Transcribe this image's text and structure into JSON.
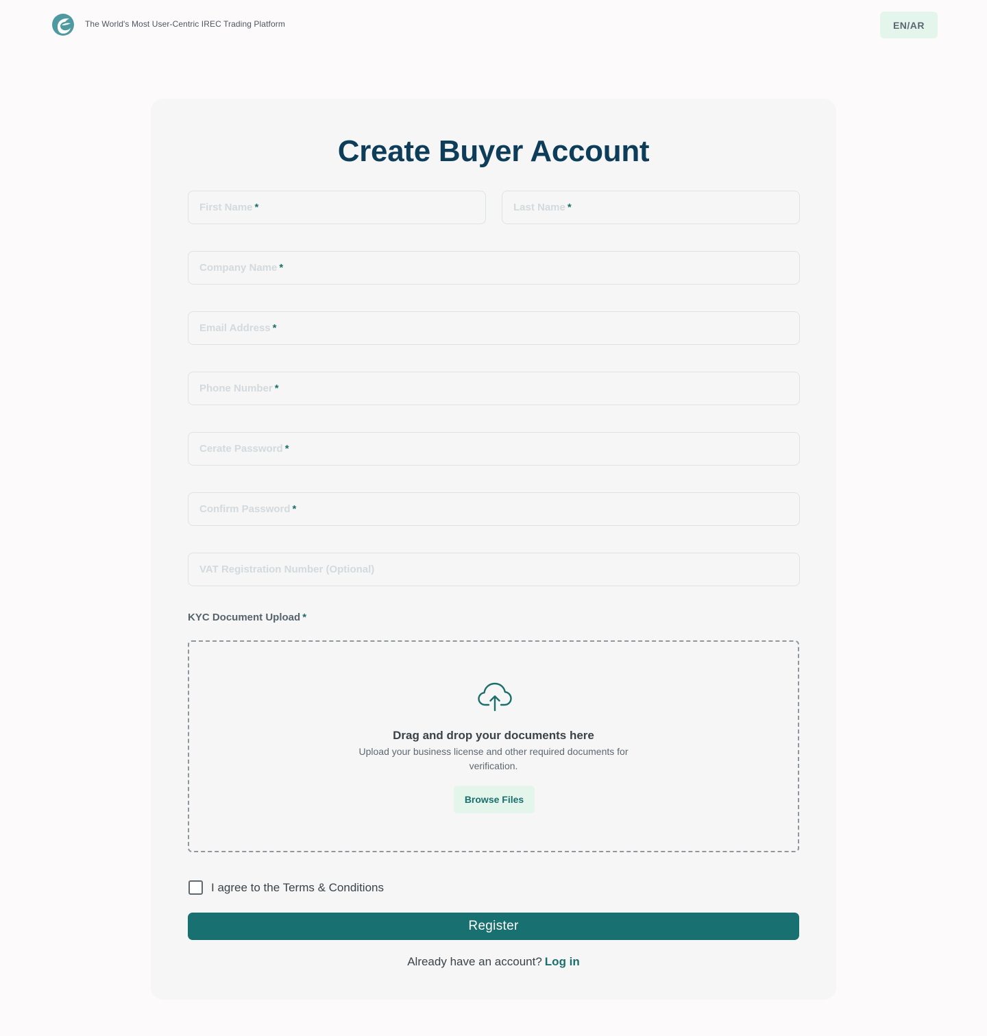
{
  "header": {
    "tagline": "The World's Most User-Centric IREC Trading Platform",
    "lang_toggle": "EN/AR",
    "logo_icon": "leaf-e-logo-icon"
  },
  "form": {
    "title": "Create Buyer Account",
    "fields": {
      "first_name": {
        "placeholder": "First Name",
        "required": "*"
      },
      "last_name": {
        "placeholder": "Last Name",
        "required": "*"
      },
      "company_name": {
        "placeholder": "Company Name",
        "required": "*"
      },
      "email": {
        "placeholder": "Email Address",
        "required": "*"
      },
      "phone": {
        "placeholder": "Phone Number",
        "required": "*"
      },
      "password": {
        "placeholder": "Cerate Password",
        "required": "*"
      },
      "confirm_password": {
        "placeholder": "Confirm Password",
        "required": "*"
      },
      "vat": {
        "placeholder": "VAT Registration Number (Optional)"
      }
    },
    "kyc": {
      "label": "KYC Document Upload",
      "required": "*",
      "icon": "cloud-upload-icon",
      "title": "Drag and drop your documents here",
      "subtitle": "Upload your business license and other required documents for verification.",
      "browse_label": "Browse Files"
    },
    "agree_text": "I agree to the Terms & Conditions",
    "register_label": "Register",
    "login_prompt": "Already have an account?",
    "login_link": "Log in"
  },
  "colors": {
    "primary": "#187170",
    "title": "#0e3d5a",
    "accent_light": "#e4f6ec",
    "card_bg": "#f5f6f5"
  }
}
